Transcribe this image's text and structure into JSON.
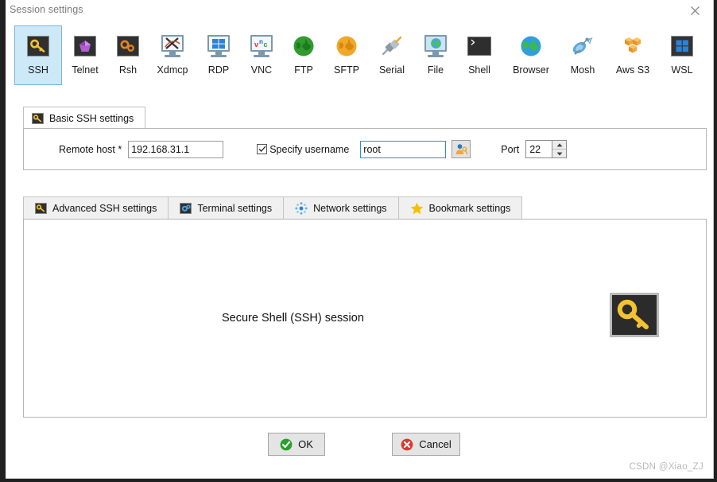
{
  "window": {
    "title": "Session settings",
    "close_label": "✕",
    "close_icon": "close-icon"
  },
  "protocols": [
    {
      "id": "ssh",
      "label": "SSH",
      "icon": "ssh-key-icon",
      "selected": true
    },
    {
      "id": "telnet",
      "label": "Telnet",
      "icon": "telnet-crystal-icon",
      "selected": false
    },
    {
      "id": "rsh",
      "label": "Rsh",
      "icon": "rsh-gears-icon",
      "selected": false
    },
    {
      "id": "xdmcp",
      "label": "Xdmcp",
      "icon": "xdmcp-monitor-icon",
      "selected": false
    },
    {
      "id": "rdp",
      "label": "RDP",
      "icon": "rdp-monitor-icon",
      "selected": false
    },
    {
      "id": "vnc",
      "label": "VNC",
      "icon": "vnc-monitor-icon",
      "selected": false
    },
    {
      "id": "ftp",
      "label": "FTP",
      "icon": "ftp-globe-green-icon",
      "selected": false
    },
    {
      "id": "sftp",
      "label": "SFTP",
      "icon": "sftp-globe-orange-icon",
      "selected": false
    },
    {
      "id": "serial",
      "label": "Serial",
      "icon": "serial-plug-icon",
      "selected": false
    },
    {
      "id": "file",
      "label": "File",
      "icon": "file-monitor-globe-icon",
      "selected": false
    },
    {
      "id": "shell",
      "label": "Shell",
      "icon": "shell-terminal-icon",
      "selected": false
    },
    {
      "id": "browser",
      "label": "Browser",
      "icon": "browser-globe-icon",
      "selected": false
    },
    {
      "id": "mosh",
      "label": "Mosh",
      "icon": "mosh-satellite-icon",
      "selected": false
    },
    {
      "id": "awss3",
      "label": "Aws S3",
      "icon": "aws-s3-cubes-icon",
      "selected": false
    },
    {
      "id": "wsl",
      "label": "WSL",
      "icon": "wsl-windows-icon",
      "selected": false
    }
  ],
  "basic_tab": {
    "label": "Basic SSH settings",
    "icon": "key-icon"
  },
  "basic_form": {
    "remote_host_label": "Remote host *",
    "remote_host_value": "192.168.31.1",
    "remote_host_placeholder": "",
    "specify_username_label": "Specify username",
    "specify_username_checked": true,
    "username_value": "root",
    "username_placeholder": "",
    "user_button_icon": "user-key-icon",
    "port_label": "Port",
    "port_value": "22",
    "spinner_up_icon": "spinner-up-icon",
    "spinner_down_icon": "spinner-down-icon"
  },
  "lower_tabs": [
    {
      "id": "advanced",
      "label": "Advanced SSH settings",
      "icon": "key-icon"
    },
    {
      "id": "terminal",
      "label": "Terminal settings",
      "icon": "terminal-gear-icon"
    },
    {
      "id": "network",
      "label": "Network settings",
      "icon": "network-dots-icon"
    },
    {
      "id": "bookmark",
      "label": "Bookmark settings",
      "icon": "star-icon"
    }
  ],
  "content": {
    "session_text": "Secure Shell (SSH) session",
    "big_icon": "ssh-key-large-icon"
  },
  "footer": {
    "ok_label": "OK",
    "ok_icon": "check-circle-icon",
    "cancel_label": "Cancel",
    "cancel_icon": "x-circle-icon"
  },
  "watermark": "CSDN @Xiao_ZJ",
  "colors": {
    "selection_fill": "#cde8f7",
    "selection_border": "#7eb4da",
    "focus_border": "#2d8fd5",
    "key_gold": "#f2c230",
    "ok_green": "#2aa02a",
    "cancel_red": "#d93b30",
    "star_yellow": "#f5c000",
    "aws_orange": "#f0a33c",
    "dialog_bg": "#ffffff"
  }
}
